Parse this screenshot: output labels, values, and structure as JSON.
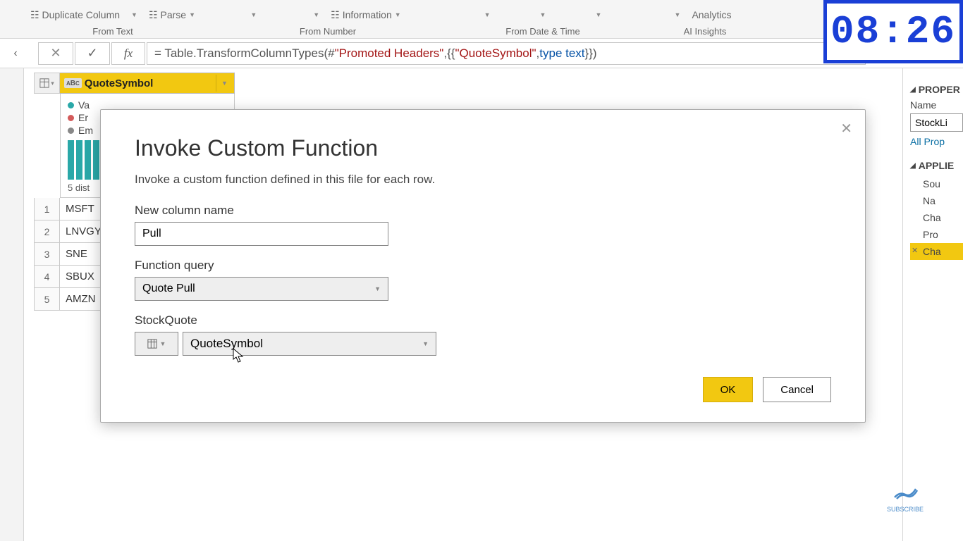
{
  "ribbon": {
    "duplicate": "Duplicate Column",
    "parse": "Parse",
    "info": "Information",
    "analytics": "Analytics",
    "g_fromtext": "From Text",
    "g_fromnumber": "From Number",
    "g_fromdate": "From Date & Time",
    "g_ai": "AI Insights"
  },
  "formula_bar": {
    "pre": "= Table.TransformColumnTypes(#",
    "str1": "\"Promoted Headers\"",
    "mid": ",{{",
    "str2": "\"QuoteSymbol\"",
    "mid2": ", ",
    "kw": "type text",
    "post": "}})"
  },
  "column": {
    "type_label": "ABC",
    "name": "QuoteSymbol",
    "preview_valid": "Va",
    "preview_error": "Er",
    "preview_empty": "Em",
    "distinct": "5 dist"
  },
  "rows": [
    "MSFT",
    "LNVGY",
    "SNE",
    "SBUX",
    "AMZN"
  ],
  "properties": {
    "section_prop": "PROPER",
    "name_label": "Name",
    "name_value": "StockLi",
    "all_props": "All Prop",
    "section_applied": "APPLIE",
    "steps": [
      "Sou",
      "Na",
      "Cha",
      "Pro",
      "Cha"
    ]
  },
  "dialog": {
    "title": "Invoke Custom Function",
    "desc": "Invoke a custom function defined in this file for each row.",
    "new_col_label": "New column name",
    "new_col_value": "Pull",
    "fn_label": "Function query",
    "fn_value": "Quote Pull",
    "param_label": "StockQuote",
    "param_value": "QuoteSymbol",
    "ok": "OK",
    "cancel": "Cancel"
  },
  "timer": "08:26",
  "subscribe": "SUBSCRIBE"
}
